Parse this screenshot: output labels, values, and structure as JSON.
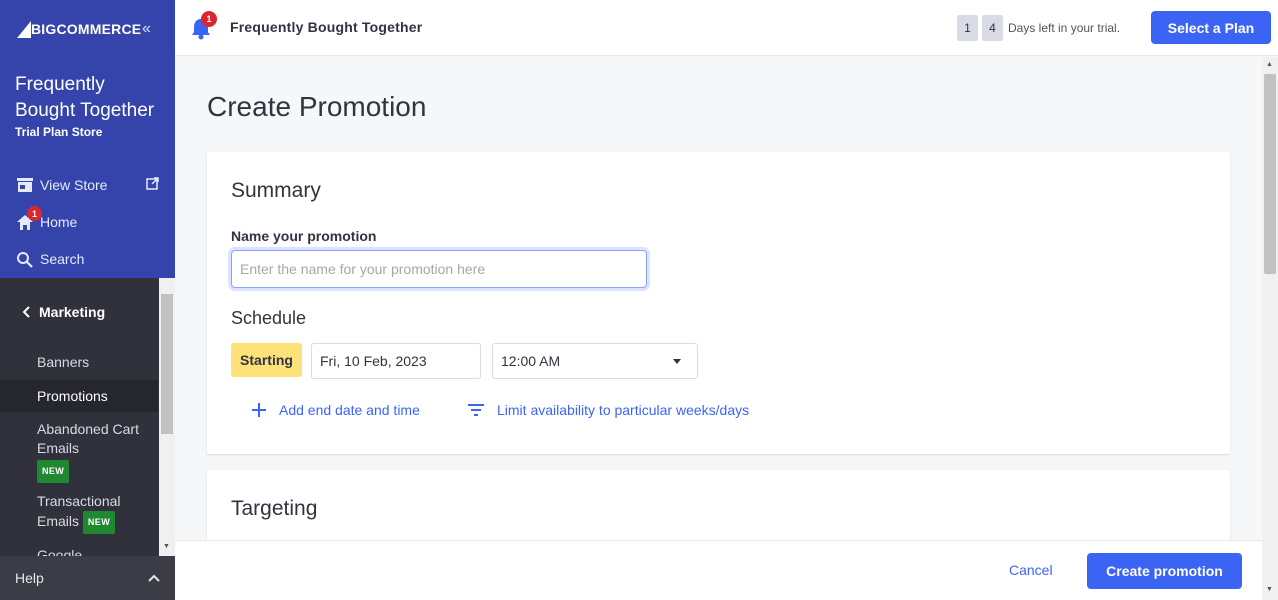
{
  "brand": {
    "logo_text": "BIGCOMMERCE",
    "accent": "#3c64f4",
    "sidebar_bg": "#3444aa"
  },
  "sidebar": {
    "store_name": "Frequently Bought Together",
    "store_plan": "Trial Plan Store",
    "links": [
      {
        "label": "View Store",
        "icon": "storefront-icon"
      },
      {
        "label": "Home",
        "icon": "home-icon",
        "badge": "1"
      },
      {
        "label": "Search",
        "icon": "search-icon"
      }
    ],
    "section": "Marketing",
    "items": [
      {
        "label": "Banners"
      },
      {
        "label": "Promotions",
        "active": true
      },
      {
        "label": "Abandoned Cart Emails",
        "badge": "NEW"
      },
      {
        "label": "Transactional Emails",
        "badge": "NEW"
      },
      {
        "label": "Google"
      }
    ],
    "help_label": "Help"
  },
  "topbar": {
    "notification_count": "1",
    "title": "Frequently Bought Together",
    "trial_digits": [
      "1",
      "4"
    ],
    "trial_text": "Days left in your trial.",
    "select_plan_label": "Select a Plan"
  },
  "main": {
    "page_title": "Create Promotion",
    "summary": {
      "heading": "Summary",
      "name_label": "Name your promotion",
      "name_placeholder": "Enter the name for your promotion here",
      "name_value": ""
    },
    "schedule": {
      "heading": "Schedule",
      "starting_label": "Starting",
      "start_date": "Fri, 10 Feb, 2023",
      "start_time": "12:00 AM",
      "add_end_label": "Add end date and time",
      "limit_label": "Limit availability to particular weeks/days"
    },
    "targeting": {
      "heading": "Targeting"
    }
  },
  "footer": {
    "cancel_label": "Cancel",
    "create_label": "Create promotion"
  }
}
